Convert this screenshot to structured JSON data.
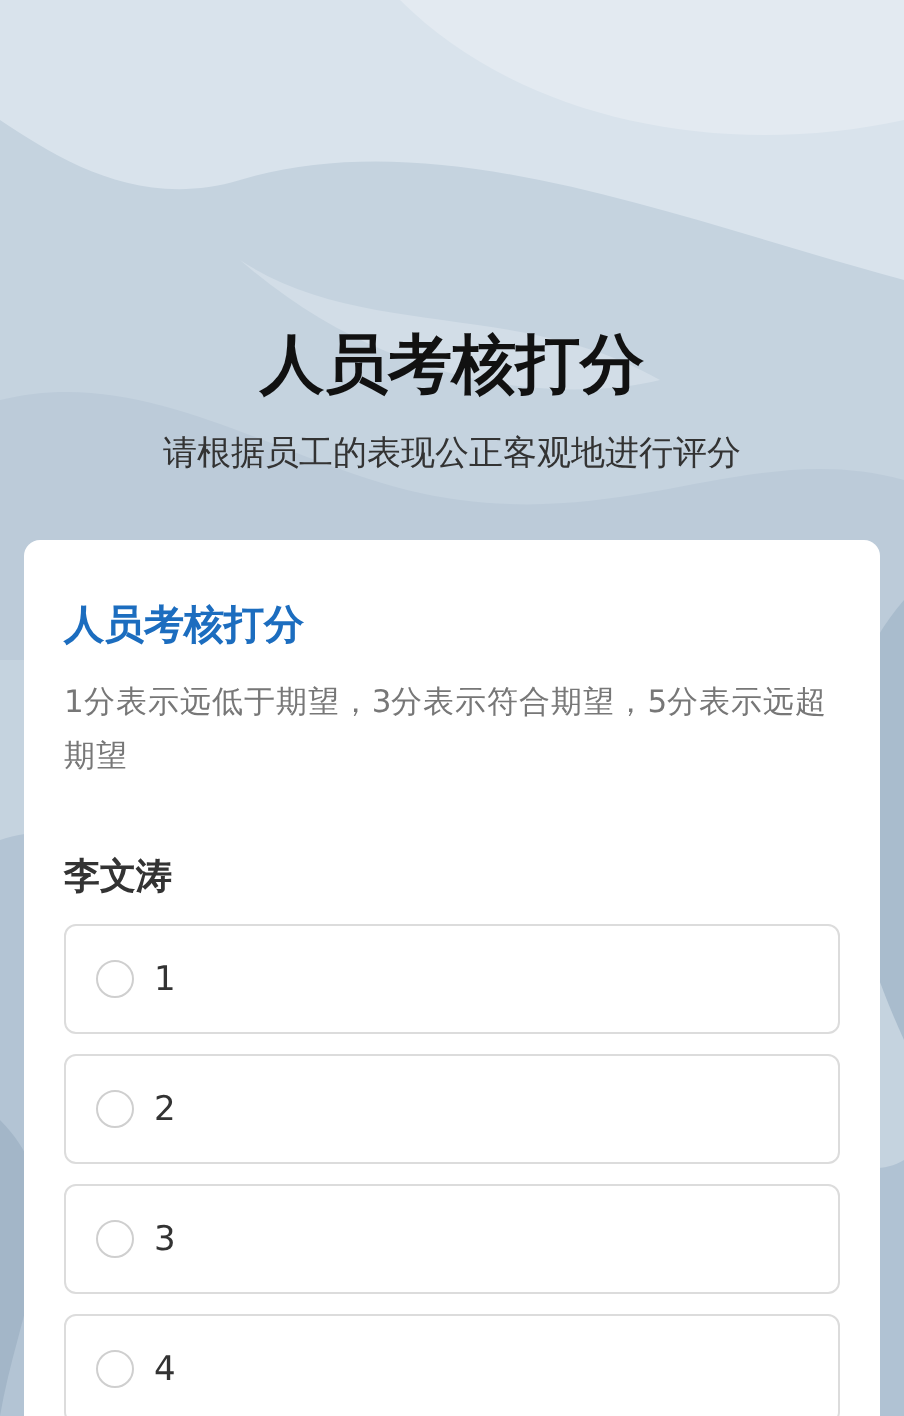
{
  "header": {
    "title": "人员考核打分",
    "subtitle": "请根据员工的表现公正客观地进行评分"
  },
  "card": {
    "title": "人员考核打分",
    "description": "1分表示远低于期望，3分表示符合期望，5分表示远超期望",
    "question": {
      "name": "李文涛",
      "options": [
        {
          "label": "1",
          "selected": false
        },
        {
          "label": "2",
          "selected": false
        },
        {
          "label": "3",
          "selected": false
        },
        {
          "label": "4",
          "selected": false
        }
      ]
    }
  }
}
